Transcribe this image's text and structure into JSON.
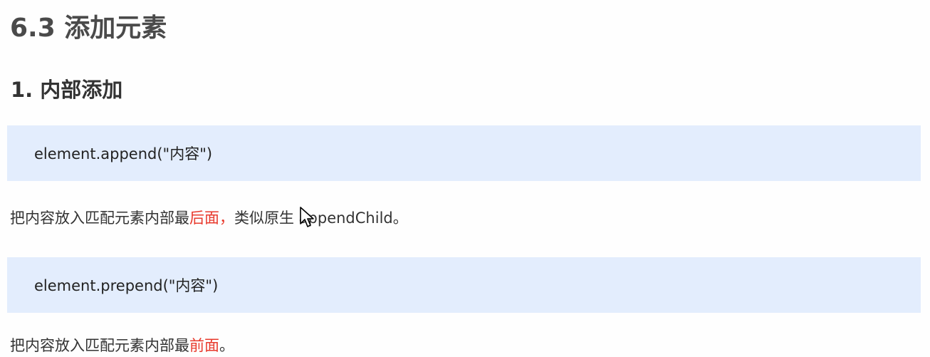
{
  "section_title": "6.3 添加元素",
  "subsection_title": "1. 内部添加",
  "blocks": [
    {
      "code": "element.append(\"内容\")",
      "desc_before": "把内容放入匹配元素内部最",
      "desc_highlight": "后面，",
      "desc_after": "类似原生 appendChild。"
    },
    {
      "code": "element.prepend(\"内容\")",
      "desc_before": "把内容放入匹配元素内部最",
      "desc_highlight": "前面",
      "desc_after": "。"
    }
  ],
  "colors": {
    "highlight": "#e8392c",
    "code_background": "#e3edfd",
    "heading": "#4a4a4a"
  }
}
